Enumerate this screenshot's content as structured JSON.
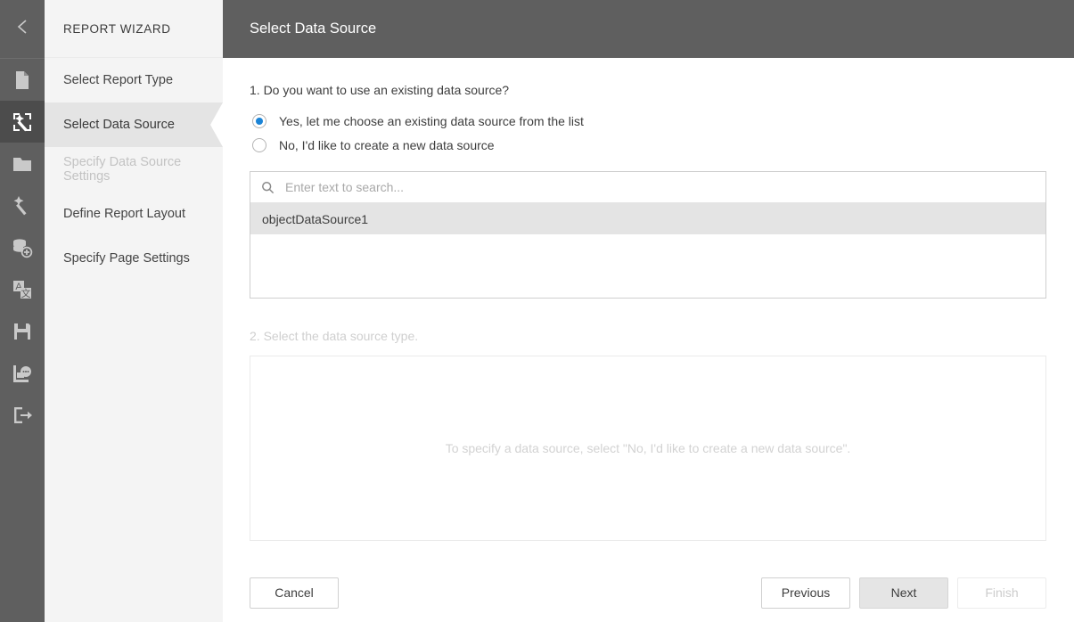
{
  "rail": {
    "back_icon": "chevron-left-icon",
    "items": [
      {
        "icon": "new-document-icon",
        "active": false
      },
      {
        "icon": "report-wizard-icon",
        "active": true
      },
      {
        "icon": "open-folder-icon",
        "active": false
      },
      {
        "icon": "magic-wand-icon",
        "active": false
      },
      {
        "icon": "add-data-source-icon",
        "active": false
      },
      {
        "icon": "localization-icon",
        "active": false
      },
      {
        "icon": "save-icon",
        "active": false
      },
      {
        "icon": "scripts-icon",
        "active": false
      },
      {
        "icon": "exit-icon",
        "active": false
      }
    ]
  },
  "sidebar": {
    "title": "REPORT WIZARD",
    "steps": [
      {
        "label": "Select Report Type",
        "state": "enabled"
      },
      {
        "label": "Select Data Source",
        "state": "active"
      },
      {
        "label": "Specify Data Source Settings",
        "state": "disabled"
      },
      {
        "label": "Define Report Layout",
        "state": "enabled"
      },
      {
        "label": "Specify Page Settings",
        "state": "enabled"
      }
    ]
  },
  "header": {
    "title": "Select Data Source"
  },
  "content": {
    "question1": "1. Do you want to use an existing data source?",
    "radios": [
      {
        "label": "Yes, let me choose an existing data source from the list",
        "checked": true
      },
      {
        "label": "No, I'd like to create a new data source",
        "checked": false
      }
    ],
    "search": {
      "placeholder": "Enter text to search...",
      "value": "",
      "icon": "search-icon"
    },
    "data_sources": [
      {
        "name": "objectDataSource1",
        "selected": true
      }
    ],
    "question2": "2. Select the data source type.",
    "type_panel_hint": "To specify a data source, select \"No, I'd like to create a new data source\"."
  },
  "footer": {
    "cancel": "Cancel",
    "previous": "Previous",
    "next": "Next",
    "finish": "Finish"
  },
  "colors": {
    "rail_bg": "#5f5f5f",
    "rail_active": "#4c4c4c",
    "sidebar_bg": "#f4f4f4",
    "sidebar_active": "#e4e4e4",
    "header_bg": "#5f5f5f",
    "accent": "#1b84d6",
    "selected_row": "#e4e4e4",
    "disabled_text": "#cfcfcf"
  }
}
